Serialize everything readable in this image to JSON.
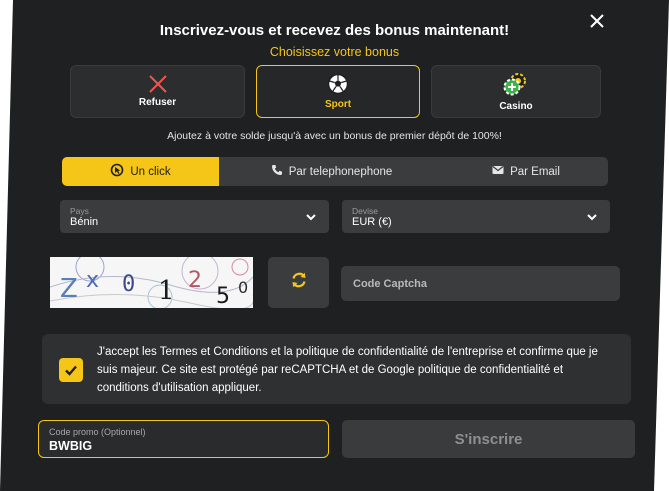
{
  "modal": {
    "title": "Inscrivez-vous et recevez des bonus maintenant!",
    "subtitle": "Choisissez votre bonus",
    "close_icon": "close-icon"
  },
  "bonus_options": [
    {
      "label": "Refuser",
      "icon": "x-icon",
      "selected": false
    },
    {
      "label": "Sport",
      "icon": "soccer-ball-icon",
      "selected": true
    },
    {
      "label": "Casino",
      "icon": "casino-chips-icon",
      "selected": false
    }
  ],
  "bonus_note": "Ajoutez à votre solde jusqu'à avec un bonus de premier dépôt de 100%!",
  "tabs": [
    {
      "label": "Un click",
      "icon": "one-click-icon",
      "active": true
    },
    {
      "label": "Par telephonephone",
      "icon": "phone-icon",
      "active": false
    },
    {
      "label": "Par Email",
      "icon": "envelope-icon",
      "active": false
    }
  ],
  "country": {
    "caption": "Pays",
    "value": "Bénin"
  },
  "currency": {
    "caption": "Devise",
    "value": "EUR (€)"
  },
  "captcha": {
    "characters": [
      "Z",
      "x",
      "0",
      "1",
      "2",
      "5",
      "0"
    ],
    "placeholder": "Code Captcha"
  },
  "terms": {
    "checked": true,
    "text": "J'accept les Termes et Conditions et la politique de confidentialité de l'entreprise et confirme que je suis majeur. Ce site est protégé par reCAPTCHA et de Google politique de confidentialité et conditions d'utilisation appliquer."
  },
  "promo": {
    "caption": "Code promo (Optionnel)",
    "value": "BWBIG"
  },
  "submit_label": "S'inscrire",
  "colors": {
    "accent": "#f5c518",
    "background": "#1f2021",
    "field": "#3b3c3e",
    "refuse_icon": "#f0544f"
  }
}
